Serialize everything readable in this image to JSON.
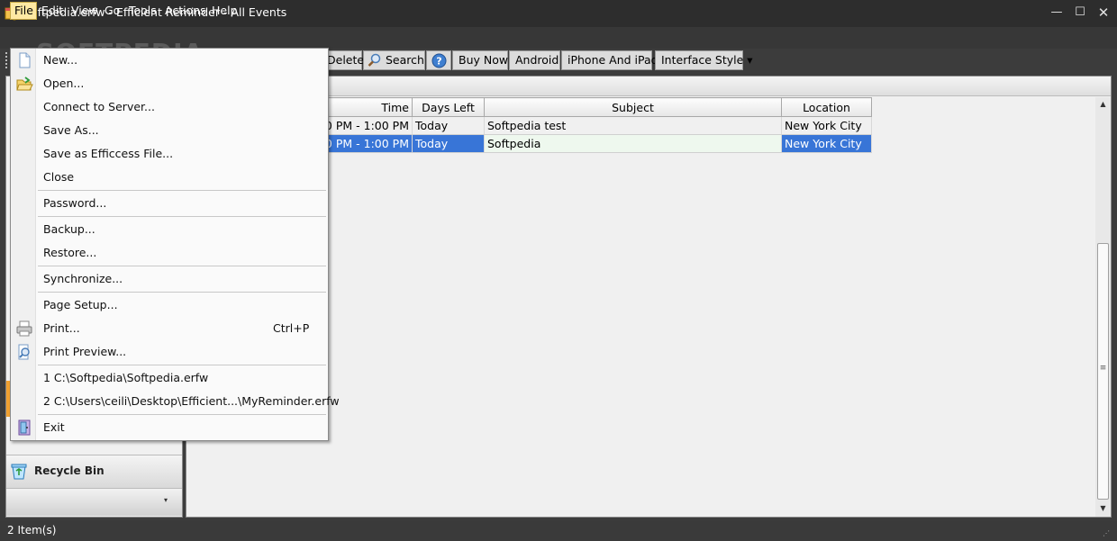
{
  "window": {
    "title": "Softpedia.erfw - Efficient Reminder - All Events",
    "min_glyph": "—",
    "max_glyph": "☐",
    "close_glyph": "✕"
  },
  "menubar": {
    "items": [
      {
        "label": "File"
      },
      {
        "label": "Edit"
      },
      {
        "label": "View"
      },
      {
        "label": "Go"
      },
      {
        "label": "Tools"
      },
      {
        "label": "Actions"
      },
      {
        "label": "Help"
      }
    ]
  },
  "toolbar": {
    "delete_label": "Delete",
    "search_label": "Search",
    "help_glyph": "?",
    "buynow_label": "Buy Now",
    "android_label": "Android",
    "iphone_label": "iPhone And iPad",
    "style_label": "Interface Style ▾"
  },
  "table": {
    "columns": [
      "Time",
      "Days Left",
      "Subject",
      "Location"
    ],
    "rows": [
      {
        "time": "0 PM - 1:00 PM",
        "days_left": "Today",
        "subject": "Softpedia test",
        "location": "New York City",
        "selected": false
      },
      {
        "time": "0 PM - 1:00 PM",
        "days_left": "Today",
        "subject": "Softpedia",
        "location": "New York City",
        "selected": true
      }
    ]
  },
  "leftnav": {
    "recycle_bin_label": "Recycle Bin",
    "more_glyph": "▾"
  },
  "filemenu": {
    "items": [
      {
        "label": "New...",
        "icon": "new-document-icon"
      },
      {
        "label": "Open...",
        "icon": "open-folder-icon"
      },
      {
        "label": "Connect to Server..."
      },
      {
        "label": "Save As..."
      },
      {
        "label": "Save as Efficcess File..."
      },
      {
        "label": "Close"
      },
      {
        "label": "Password..."
      },
      {
        "label": "Backup..."
      },
      {
        "label": "Restore..."
      },
      {
        "label": "Synchronize..."
      },
      {
        "label": "Page Setup..."
      },
      {
        "label": "Print...",
        "icon": "printer-icon",
        "shortcut": "Ctrl+P"
      },
      {
        "label": "Print Preview...",
        "icon": "print-preview-icon"
      },
      {
        "label": "1 C:\\Softpedia\\Softpedia.erfw"
      },
      {
        "label": "2 C:\\Users\\ceili\\Desktop\\Efficient...\\MyReminder.erfw"
      },
      {
        "label": "Exit",
        "icon": "exit-icon"
      }
    ]
  },
  "scrollbar": {
    "up_glyph": "▲",
    "down_glyph": "▼",
    "grip_glyph": "≡"
  },
  "status": {
    "text": "2 Item(s)",
    "grip_glyph": "⋰"
  },
  "watermark": "SOFTPEDIA",
  "colors": {
    "accent_selection": "#3875d7",
    "menu_highlight": "#ffe9a3",
    "chrome_dark": "#3c3c3c"
  }
}
